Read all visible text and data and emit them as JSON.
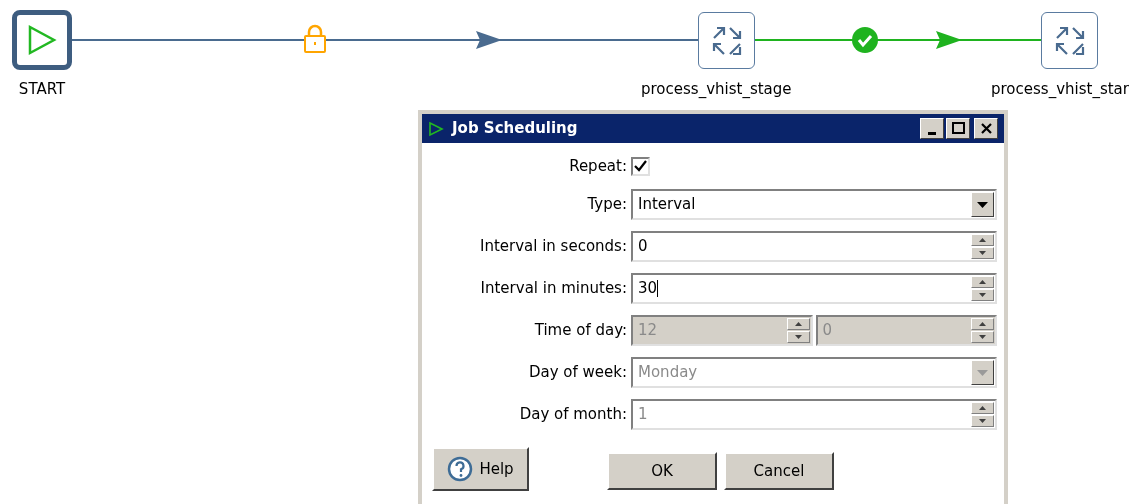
{
  "nodes": [
    {
      "label": "START",
      "kind": "start"
    },
    {
      "label": "process_vhist_stage",
      "kind": "transform"
    },
    {
      "label": "process_vhist_star",
      "kind": "transform"
    }
  ],
  "hops": [
    {
      "kind": "locked"
    },
    {
      "kind": "success"
    }
  ],
  "dialog": {
    "title": "Job Scheduling",
    "fields": [
      {
        "label": "Repeat:",
        "kind": "checkbox",
        "checked": true
      },
      {
        "label": "Type:",
        "kind": "dropdown",
        "value": "Interval",
        "disabled": false
      },
      {
        "label": "Interval in seconds:",
        "kind": "spinner",
        "value": "0",
        "disabled": false,
        "focused": false
      },
      {
        "label": "Interval in minutes:",
        "kind": "spinner",
        "value": "30",
        "disabled": false,
        "focused": true
      },
      {
        "label": "Time of day:",
        "kind": "spinner_pair",
        "values": [
          "12",
          "0"
        ],
        "disabled": true
      },
      {
        "label": "Day of week:",
        "kind": "dropdown",
        "value": "Monday",
        "disabled": true
      },
      {
        "label": "Day of month:",
        "kind": "spinner",
        "value": "1",
        "disabled": true,
        "focused": false
      }
    ],
    "buttons": [
      {
        "label": "Help",
        "kind": "help"
      },
      {
        "label": "OK",
        "kind": "normal"
      },
      {
        "label": "Cancel",
        "kind": "normal"
      }
    ]
  }
}
